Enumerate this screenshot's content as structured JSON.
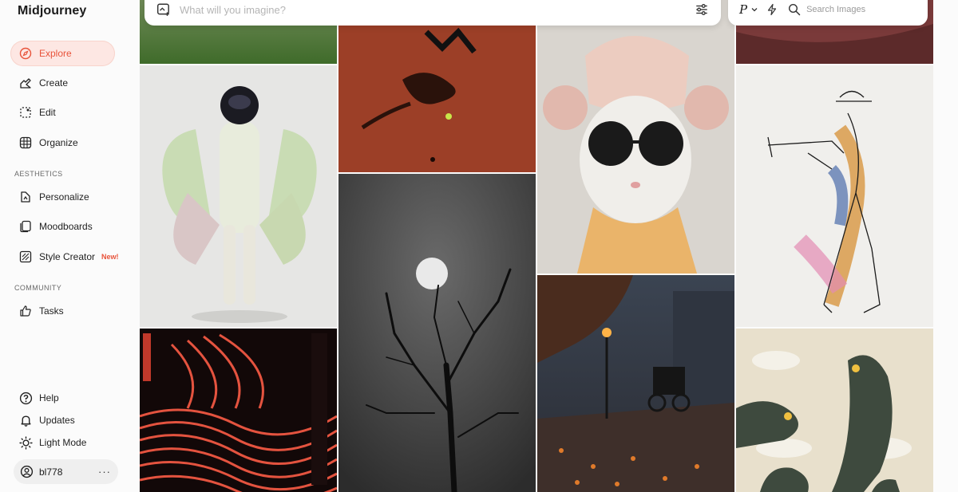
{
  "app": {
    "title": "Midjourney"
  },
  "nav": {
    "explore": "Explore",
    "create": "Create",
    "edit": "Edit",
    "organize": "Organize",
    "aesthetics_label": "AESTHETICS",
    "personalize": "Personalize",
    "moodboards": "Moodboards",
    "style_creator": "Style Creator",
    "style_creator_badge": "New!",
    "community_label": "COMMUNITY",
    "tasks": "Tasks",
    "help": "Help",
    "updates": "Updates",
    "light_mode": "Light Mode",
    "username": "bl778",
    "more": "···"
  },
  "prompt": {
    "placeholder": "What will you imagine?"
  },
  "search": {
    "version_label": "P",
    "placeholder": "Search Images"
  },
  "colors": {
    "accent": "#e8533a",
    "active_bg": "#fde7e3"
  },
  "icons": [
    "compass-icon",
    "create-icon",
    "edit-icon",
    "organize-grid-icon",
    "personalize-icon",
    "moodboards-icon",
    "style-creator-icon",
    "thumbs-up-icon",
    "help-icon",
    "bell-icon",
    "sun-icon",
    "user-circle-icon",
    "image-add-icon",
    "sliders-icon",
    "chevron-down-icon",
    "lightning-icon",
    "search-icon"
  ],
  "gallery": [
    "grass-field-image",
    "tennis-player-image",
    "mouse-sunglasses-image",
    "red-shirt-image",
    "green-humanoid-figure-image",
    "trumpet-player-sketch-image",
    "moon-tree-image",
    "autumn-street-carriage-image",
    "red-waves-poster-image",
    "pigeons-illustration-image"
  ]
}
